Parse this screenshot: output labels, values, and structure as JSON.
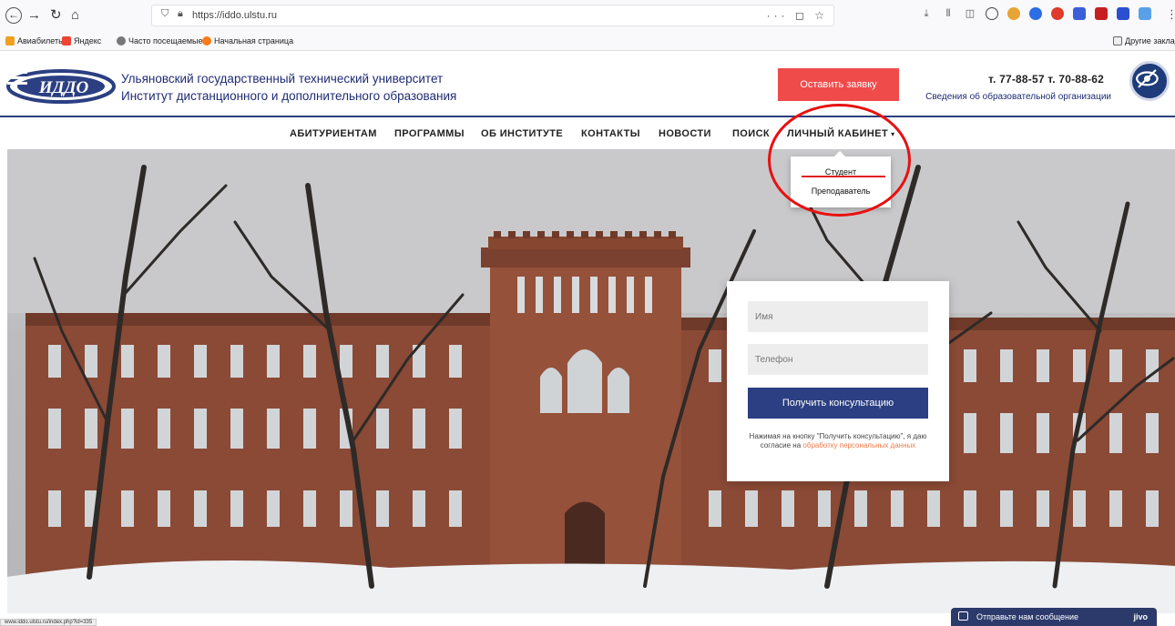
{
  "browser": {
    "url_text": "https://iddo.ulstu.ru",
    "url_actions": "··· ◻ ☆",
    "bookmarks": [
      "Авиабилеты",
      "Яндекс",
      "Часто посещаемые",
      "Начальная страница"
    ],
    "other_bookmarks": "Другие заклад"
  },
  "header": {
    "logo_text": "ИДДО",
    "org_line1": "Ульяновский государственный технический университет",
    "org_line2": "Институт дистанционного и дополнительного образования",
    "cta_button": "Оставить заявку",
    "phone": "т. 77-88-57 т. 70-88-62",
    "org_info_link": "Сведения об образовательной организации"
  },
  "nav": {
    "items": [
      "АБИТУРИЕНТАМ",
      "ПРОГРАММЫ",
      "ОБ ИНСТИТУТЕ",
      "КОНТАКТЫ",
      "НОВОСТИ",
      "ПОИСК"
    ],
    "cabinet": "ЛИЧНЫЙ КАБИНЕТ",
    "cabinet_menu": [
      "Студент",
      "Преподаватель"
    ]
  },
  "form": {
    "name_placeholder": "Имя",
    "phone_placeholder": "Телефон",
    "submit": "Получить консультацию",
    "consent_text": "Нажимая на кнопку \"Получить консультацию\", я даю согласие на",
    "consent_link": "обработку персональных данных"
  },
  "status_url": "www.iddo.ulstu.ru/index.php?id=335",
  "chat": {
    "label": "Отправьте нам сообщение",
    "brand": "jivo"
  },
  "colors": {
    "brand_blue": "#1e2b73",
    "cta_red": "#f04b4b",
    "button_blue": "#2b3f82",
    "annotation_red": "#e81010"
  }
}
